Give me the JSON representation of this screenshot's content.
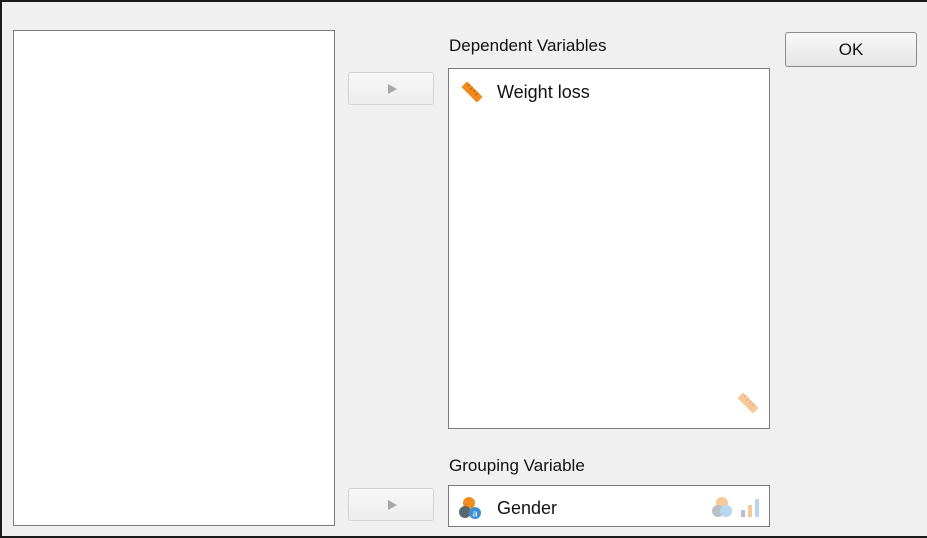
{
  "dialog": {
    "source_list": {
      "items": []
    },
    "dependent": {
      "label": "Dependent Variables",
      "items": [
        {
          "name": "Weight loss",
          "icon": "ruler-icon"
        }
      ],
      "accepts_icon": "ruler-icon"
    },
    "grouping": {
      "label": "Grouping Variable",
      "item": {
        "name": "Gender",
        "icon": "nominal-text-icon"
      },
      "accepts_icons": [
        "nominal-icon",
        "ordinal-icon"
      ]
    },
    "buttons": {
      "ok_label": "OK"
    }
  },
  "colors": {
    "ruler_orange": "#f28a1e",
    "ruler_faded": "#f6c99a",
    "nominal_orange": "#f28a1e",
    "nominal_grey": "#5b6770",
    "text_badge_blue": "#3d8fd6",
    "ordinal_blue": "#7fb8e6"
  }
}
